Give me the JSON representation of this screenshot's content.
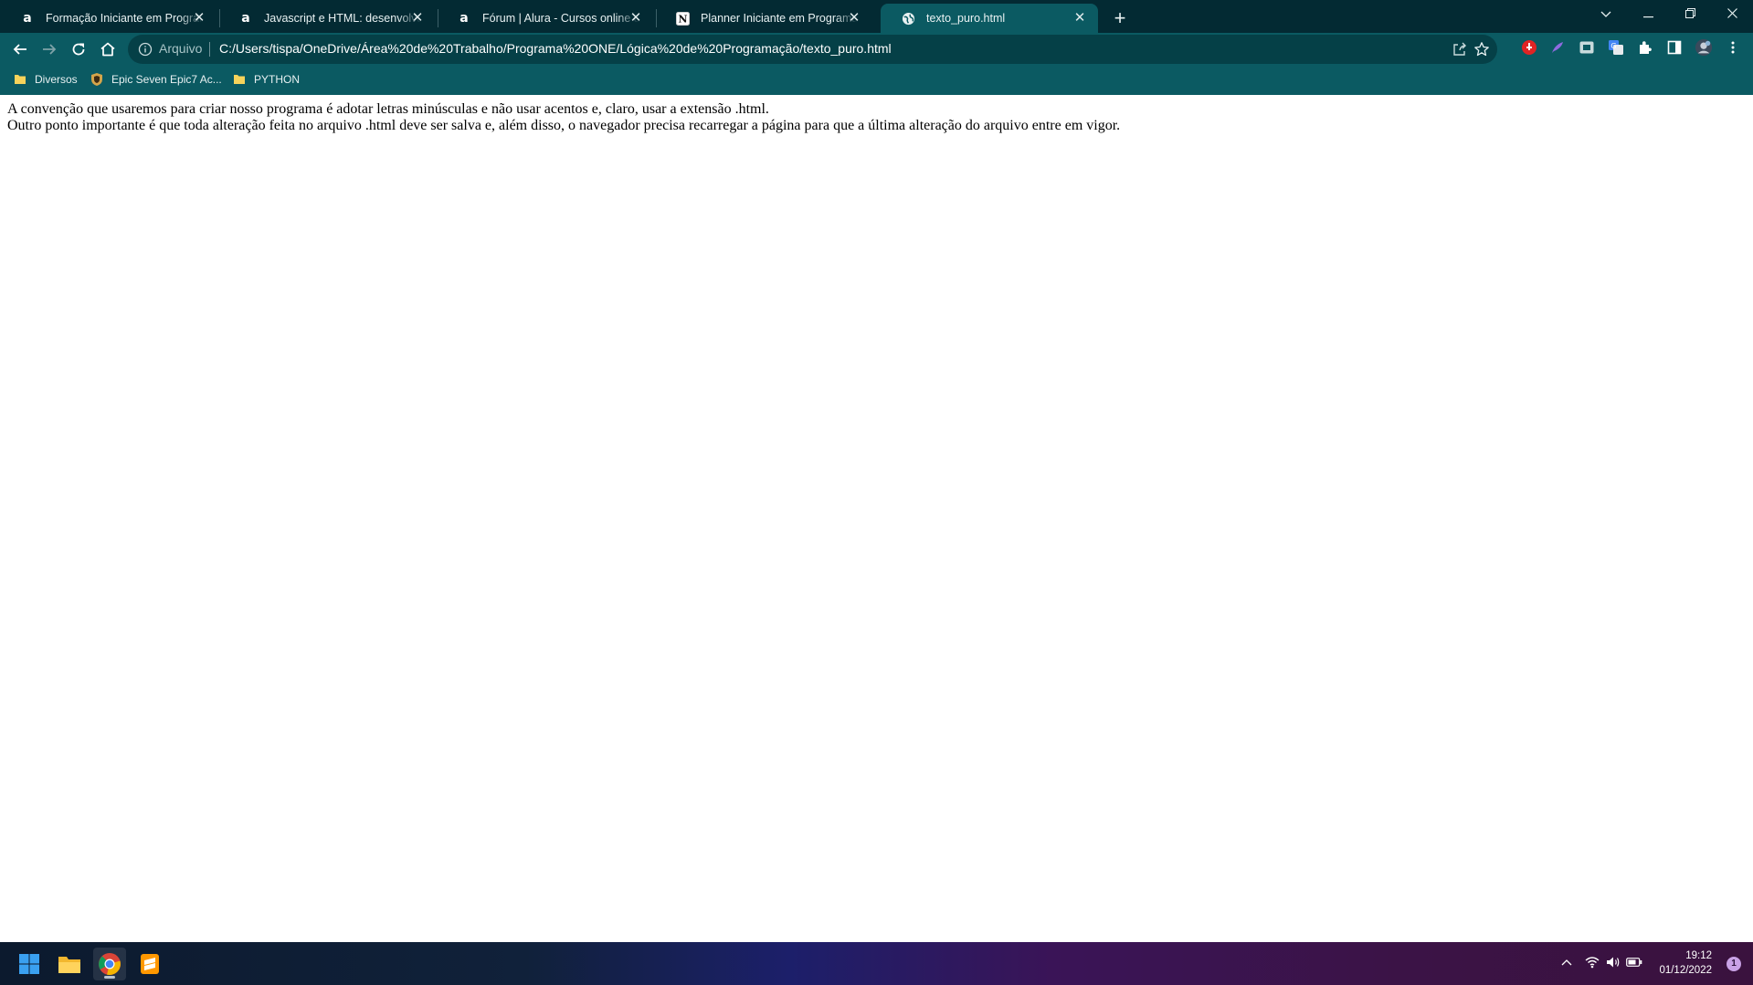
{
  "browser": {
    "tabs": [
      {
        "title": "Formação Iniciante em Programação",
        "favicon": "alura-icon",
        "active": false
      },
      {
        "title": "Javascript e HTML: desenvolva um jogo",
        "favicon": "alura-icon",
        "active": false
      },
      {
        "title": "Fórum | Alura - Cursos online de tecnologia",
        "favicon": "alura-icon",
        "active": false
      },
      {
        "title": "Planner Iniciante em Programação",
        "favicon": "notion-icon",
        "active": false
      },
      {
        "title": "texto_puro.html",
        "favicon": "globe-icon",
        "active": true
      }
    ],
    "omnibox": {
      "scheme_label": "Arquivo",
      "url": "C:/Users/tispa/OneDrive/Área%20de%20Trabalho/Programa%20ONE/Lógica%20de%20Programação/texto_puro.html"
    },
    "bookmarks": [
      {
        "label": "Diversos",
        "icon": "folder-icon"
      },
      {
        "label": "Epic Seven Epic7 Ac...",
        "icon": "shield-icon"
      },
      {
        "label": "PYTHON",
        "icon": "folder-icon"
      }
    ],
    "colors": {
      "tabstrip": "#032a33",
      "toolbar": "#0b5a62",
      "omnibox": "#054047"
    }
  },
  "page": {
    "line1": "A convenção que usaremos para criar nosso programa é adotar letras minúsculas e não usar acentos e, claro, usar a extensão .html.",
    "line2": "Outro ponto importante é que toda alteração feita no arquivo .html deve ser salva e, além disso, o navegador precisa recarregar a página para que a última alteração do arquivo entre em vigor."
  },
  "taskbar": {
    "apps": [
      {
        "name": "windows-start-icon"
      },
      {
        "name": "file-explorer-icon"
      },
      {
        "name": "chrome-icon",
        "active": true
      },
      {
        "name": "sublime-text-icon"
      }
    ],
    "clock": {
      "time": "19:12",
      "date": "01/12/2022"
    },
    "notification_count": "1"
  }
}
